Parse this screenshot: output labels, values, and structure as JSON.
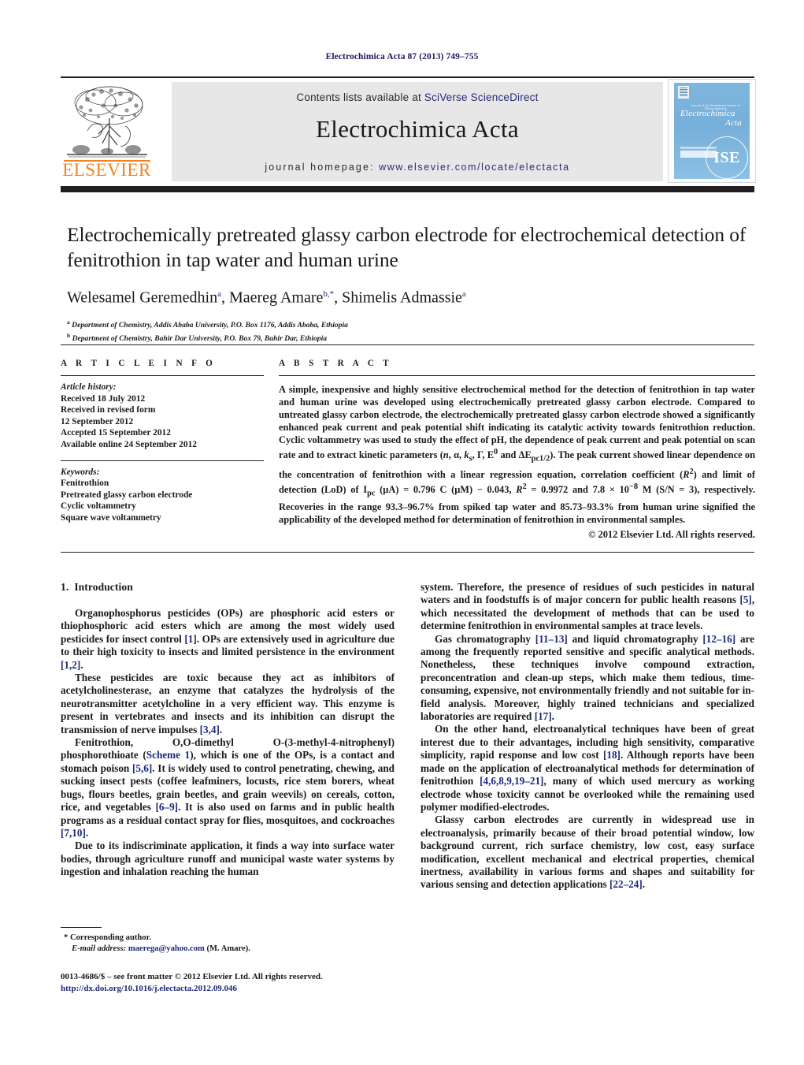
{
  "running_head": "Electrochimica Acta 87 (2013) 749–755",
  "masthead": {
    "contents_prefix": "Contents lists available at ",
    "contents_link": "SciVerse ScienceDirect",
    "journal_title": "Electrochimica Acta",
    "homepage_prefix": "journal homepage:",
    "homepage_link": "www.elsevier.com/locate/electacta",
    "publisher_wordmark": "ELSEVIER",
    "publisher_logo_icon": "elsevier-tree-icon",
    "cover": {
      "society_line": "Journal of the International Society of Electrochemistry",
      "title_line1": "Electrochimica",
      "title_line2": "Acta",
      "society_badge": "ISE",
      "publisher_mark_icon": "elsevier-mark-icon"
    },
    "link_color": "#2a2a7a",
    "panel_color": "#e7e7e7",
    "wordmark_color": "#f58220"
  },
  "article": {
    "title": "Electrochemically pretreated glassy carbon electrode for electrochemical detection of fenitrothion in tap water and human urine",
    "authors_html": "Welesamel Geremedhin<sup>a</sup>, Maereg Amare<sup>b,*</sup>, Shimelis Admassie<sup>a</sup>",
    "authors_plain": "Welesamel Geremedhin a, Maereg Amare b,*, Shimelis Admassie a",
    "affiliations": [
      "a Department of Chemistry, Addis Ababa University, P.O. Box 1176, Addis Ababa, Ethiopia",
      "b Department of Chemistry, Bahir Dar University, P.O. Box 79, Bahir Dar, Ethiopia"
    ],
    "affiliation_a_html": "<sup>a</sup> Department of Chemistry, Addis Ababa University, P.O. Box 1176, Addis Ababa, Ethiopia",
    "affiliation_b_html": "<sup>b</sup> Department of Chemistry, Bahir Dar University, P.O. Box 79, Bahir Dar, Ethiopia"
  },
  "article_info": {
    "heading": "A R T I C L E   I N F O",
    "history_label": "Article history:",
    "history": [
      "Received 18 July 2012",
      "Received in revised form",
      "12 September 2012",
      "Accepted 15 September 2012",
      "Available online 24 September 2012"
    ],
    "keywords_label": "Keywords:",
    "keywords": [
      "Fenitrothion",
      "Pretreated glassy carbon electrode",
      "Cyclic voltammetry",
      "Square wave voltammetry"
    ]
  },
  "abstract": {
    "heading": "A B S T R A C T",
    "body_html": "A simple, inexpensive and highly sensitive electrochemical method for the detection of fenitrothion in tap water and human urine was developed using electrochemically pretreated glassy carbon electrode. Compared to untreated glassy carbon electrode, the electrochemically pretreated glassy carbon electrode showed a significantly enhanced peak current and peak potential shift indicating its catalytic activity towards fenitrothion reduction. Cyclic voltammetry was used to study the effect of pH, the dependence of peak current and peak potential on scan rate and to extract kinetic parameters (<i>n</i>, &alpha;, <i>k</i><sub>s</sub>, &Gamma;, E<sup>0</sup> and &Delta;E<sub>pc1/2</sub>). The peak current showed linear dependence on the concentration of fenitrothion with a linear regression equation, correlation coefficient (<i>R</i><sup>2</sup>) and limit of detection (LoD) of I<sub>pc</sub> (&mu;A) = 0.796 C (&mu;M) &minus; 0.043, <i>R</i><sup>2</sup> = 0.9972 and 7.8 &times; 10<sup>&minus;8</sup> M (S/N = 3), respectively. Recoveries in the range 93.3&ndash;96.7% from spiked tap water and 85.73&ndash;93.3% from human urine signified the applicability of the developed method for determination of fenitrothion in environmental samples.",
    "copyright": "© 2012 Elsevier Ltd. All rights reserved."
  },
  "section": {
    "number": "1.",
    "title": "Introduction"
  },
  "body": {
    "left_paragraphs_html": [
      "Organophosphorus pesticides (OPs) are phosphoric acid esters or thiophosphoric acid esters which are among the most widely used pesticides for insect control <span class=\"ref\">[1]</span>. OPs are extensively used in agriculture due to their high toxicity to insects and limited persistence in the environment <span class=\"ref\">[1,2]</span>.",
      "These pesticides are toxic because they act as inhibitors of acetylcholinesterase, an enzyme that catalyzes the hydrolysis of the neurotransmitter acetylcholine in a very efficient way. This enzyme is present in vertebrates and insects and its inhibition can disrupt the transmission of nerve impulses <span class=\"ref\">[3,4]</span>.",
      "Fenitrothion, O,O-dimethyl O-(3-methyl-4-nitrophenyl) phosphorothioate (<span class=\"ref\">Scheme 1</span>), which is one of the OPs, is a contact and stomach poison <span class=\"ref\">[5,6]</span>. It is widely used to control penetrating, chewing, and sucking insect pests (coffee leafminers, locusts, rice stem borers, wheat bugs, flours beetles, grain beetles, and grain weevils) on cereals, cotton, rice, and vegetables <span class=\"ref\">[6–9]</span>. It is also used on farms and in public health programs as a residual contact spray for flies, mosquitoes, and cockroaches <span class=\"ref\">[7,10]</span>.",
      "Due to its indiscriminate application, it finds a way into surface water bodies, through agriculture runoff and municipal waste water systems by ingestion and inhalation reaching the human"
    ],
    "right_paragraphs_html": [
      "system. Therefore, the presence of residues of such pesticides in natural waters and in foodstuffs is of major concern for public health reasons <span class=\"ref\">[5]</span>, which necessitated the development of methods that can be used to determine fenitrothion in environmental samples at trace levels.",
      "Gas chromatography <span class=\"ref\">[11–13]</span> and liquid chromatography <span class=\"ref\">[12–16]</span> are among the frequently reported sensitive and specific analytical methods. Nonetheless, these techniques involve compound extraction, preconcentration and clean-up steps, which make them tedious, time-consuming, expensive, not environmentally friendly and not suitable for in-field analysis. Moreover, highly trained technicians and specialized laboratories are required <span class=\"ref\">[17]</span>.",
      "On the other hand, electroanalytical techniques have been of great interest due to their advantages, including high sensitivity, comparative simplicity, rapid response and low cost <span class=\"ref\">[18]</span>. Although reports have been made on the application of electroanalytical methods for determination of fenitrothion <span class=\"ref\">[4,6,8,9,19–21]</span>, many of which used mercury as working electrode whose toxicity cannot be overlooked while the remaining used polymer modified-electrodes.",
      "Glassy carbon electrodes are currently in widespread use in electroanalysis, primarily because of their broad potential window, low background current, rich surface chemistry, low cost, easy surface modification, excellent mechanical and electrical properties, chemical inertness, availability in various forms and shapes and suitability for various sensing and detection applications <span class=\"ref\">[22–24]</span>."
    ]
  },
  "footnote": {
    "corresponding_label": "* Corresponding author.",
    "email_label": "E-mail address:",
    "email": "maerega@yahoo.com",
    "email_suffix": "(M. Amare)."
  },
  "imprint": {
    "issn_line": "0013-4686/$ – see front matter © 2012 Elsevier Ltd. All rights reserved.",
    "doi": "http://dx.doi.org/10.1016/j.electacta.2012.09.046"
  }
}
